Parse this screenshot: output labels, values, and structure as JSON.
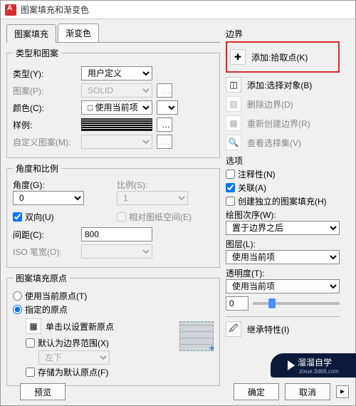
{
  "window": {
    "title": "图案填充和渐变色"
  },
  "tabs": {
    "hatch": "图案填充",
    "gradient": "渐变色"
  },
  "typePattern": {
    "legend": "类型和图案",
    "typeLabel": "类型(Y):",
    "typeValue": "用户定义",
    "patternLabel": "图案(P):",
    "patternValue": "SOLID",
    "colorLabel": "颜色(C):",
    "colorValue": "□ 使用当前项",
    "sampleLabel": "样例:",
    "customLabel": "自定义图案(M):"
  },
  "angleScale": {
    "legend": "角度和比例",
    "angleLabel": "角度(G):",
    "angleValue": "0",
    "scaleLabel": "比例(S):",
    "scaleValue": "1",
    "doubleLabel": "双向(U)",
    "relativeLabel": "相对图纸空间(E)",
    "spacingLabel": "间距(C):",
    "spacingValue": "800",
    "isoLabel": "ISO 笔宽(O):"
  },
  "origin": {
    "legend": "图案填充原点",
    "useCurrent": "使用当前原点(T)",
    "specified": "指定的原点",
    "clickNew": "单击以设置新原点",
    "defaultBoundary": "默认为边界范围(X)",
    "position": "左下",
    "storeDefault": "存储为默认原点(F)"
  },
  "boundary": {
    "title": "边界",
    "addPick": "添加:拾取点(K)",
    "addSelect": "添加:选择对象(B)",
    "removeBoundary": "删除边界(D)",
    "recreateBoundary": "重新创建边界(R)",
    "viewSelection": "查看选择集(V)"
  },
  "options": {
    "title": "选项",
    "annotative": "注释性(N)",
    "associative": "关联(A)",
    "independent": "创建独立的图案填充(H)",
    "drawOrderLabel": "绘图次序(W):",
    "drawOrderValue": "置于边界之后",
    "layerLabel": "图层(L):",
    "layerValue": "使用当前项",
    "transparencyLabel": "透明度(T):",
    "transparencyValue": "使用当前项",
    "sliderValue": "0"
  },
  "inherit": {
    "label": "继承特性(I)"
  },
  "footer": {
    "preview": "预览",
    "ok": "确定",
    "cancel": "取消"
  },
  "watermark": {
    "brand": "溜溜自学",
    "sub": "zixue.3d66.com"
  }
}
